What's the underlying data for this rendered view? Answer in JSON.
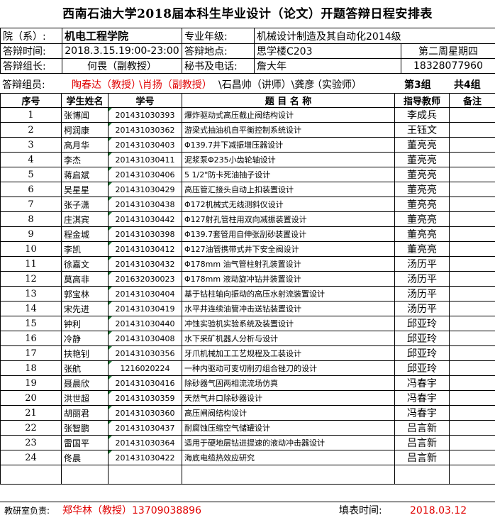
{
  "title": "西南石油大学2018届本科生毕业设计（论文）开题答辩日程安排表",
  "info": {
    "dept_label": "院（系）:",
    "dept_value": "机电工程学院",
    "major_label": "专业年级:",
    "major_value": "机械设计制造及其自动化2014级",
    "time_label": "答辩时间:",
    "time_value": "2018.3.15.19:00-23:00",
    "place_label": "答辩地点:",
    "place_value": "思学楼C203",
    "week_value": "第二周星期四",
    "leader_label": "答辩组长:",
    "leader_value": "何畏（副教授）",
    "secretary_label": "秘书及电话:",
    "secretary_name": "詹大年",
    "secretary_phone": "18328077960",
    "members_label": "答辩组员:",
    "member_1": "陶春达（教授）",
    "member_2": "\\肖扬（副教授）",
    "member_3": "\\石昌帅（讲师）\\龚彦",
    "member_4": "（实验师）",
    "group_value": "第3组",
    "total_value": "共4组"
  },
  "columns": {
    "no": "序号",
    "student": "学生姓名",
    "id": "学号",
    "topic": "题 目 名 称",
    "advisor": "指导教师",
    "note": "备注"
  },
  "rows": [
    {
      "no": "1",
      "student": "张博闻",
      "id": "201431030393",
      "topic": "爆炸驱动式高压截止阀结构设计",
      "advisor": "李成兵"
    },
    {
      "no": "2",
      "student": "柯润康",
      "id": "201431030362",
      "topic": "游梁式抽油机自平衡控制系统设计",
      "advisor": "王钰文"
    },
    {
      "no": "3",
      "student": "高月华",
      "id": "201431030403",
      "topic": "Φ139.7井下减振增压器设计",
      "advisor": "董亮亮"
    },
    {
      "no": "4",
      "student": "李杰",
      "id": "201431030411",
      "topic": "泥浆泵Φ235小齿轮轴设计",
      "advisor": "董亮亮"
    },
    {
      "no": "5",
      "student": "蒋启斌",
      "id": "201431030406",
      "topic": "5 1/2\"防卡死油抽子设计",
      "advisor": "董亮亮"
    },
    {
      "no": "6",
      "student": "吴星星",
      "id": "201431030429",
      "topic": "高压管汇接头自动上扣装置设计",
      "advisor": "董亮亮"
    },
    {
      "no": "7",
      "student": "张子潇",
      "id": "201431030438",
      "topic": "Φ172机械式无线测斜仪设计",
      "advisor": "董亮亮"
    },
    {
      "no": "8",
      "student": "庄淇宾",
      "id": "201431030442",
      "topic": "Φ127射孔管柱用双向减振装置设计",
      "advisor": "董亮亮"
    },
    {
      "no": "9",
      "student": "程金城",
      "id": "201431030398",
      "topic": "Φ139.7套管用自伸张刮砂装置设计",
      "advisor": "董亮亮"
    },
    {
      "no": "10",
      "student": "李凯",
      "id": "201431030412",
      "topic": "Φ127油管携带式井下安全阀设计",
      "advisor": "董亮亮"
    },
    {
      "no": "11",
      "student": "徐嘉文",
      "id": "201431030432",
      "topic": "Φ178mm 油气管柱射孔装置设计",
      "advisor": "汤历平"
    },
    {
      "no": "12",
      "student": "莫高非",
      "id": "201632030023",
      "topic": "Φ178mm 液动旋冲钻井装置设计",
      "advisor": "汤历平"
    },
    {
      "no": "13",
      "student": "郭宝林",
      "id": "201431030404",
      "topic": "基于钻柱轴向振动的高压水射流装置设计",
      "advisor": "汤历平"
    },
    {
      "no": "14",
      "student": "宋先进",
      "id": "201431030419",
      "topic": "水平井连续油管冲击送钻装置设计",
      "advisor": "汤历平"
    },
    {
      "no": "15",
      "student": "钟利",
      "id": "201431030440",
      "topic": "冲蚀实验机实验系统及装置设计",
      "advisor": "邱亚玲"
    },
    {
      "no": "16",
      "student": "冷静",
      "id": "201431030408",
      "topic": "水下采矿机器人分析与设计",
      "advisor": "邱亚玲"
    },
    {
      "no": "17",
      "student": "扶艳钊",
      "id": "201431030356",
      "topic": "牙爪机械加工工艺规程及工装设计",
      "advisor": "邱亚玲"
    },
    {
      "no": "18",
      "student": "张航",
      "id": "1216020224",
      "topic": "一种内驱动可变切削刃组合锉刀的设计",
      "advisor": "邱亚玲"
    },
    {
      "no": "19",
      "student": "聂晨欣",
      "id": "201431030416",
      "topic": "除砂器气固两相流流场仿真",
      "advisor": "冯春宇"
    },
    {
      "no": "20",
      "student": "洪世超",
      "id": "201431030359",
      "topic": "天然气井口除砂器设计",
      "advisor": "冯春宇"
    },
    {
      "no": "21",
      "student": "胡丽君",
      "id": "201431030360",
      "topic": "高压闸阀结构设计",
      "advisor": "冯春宇"
    },
    {
      "no": "22",
      "student": "张智鹏",
      "id": "201431030437",
      "topic": "耐腐蚀压缩空气储罐设计",
      "advisor": "吕言新"
    },
    {
      "no": "23",
      "student": "雷国平",
      "id": "201431030364",
      "topic": "适用于硬地层钻进提速的液动冲击器设计",
      "advisor": "吕言新"
    },
    {
      "no": "24",
      "student": "佟晨",
      "id": "201431030422",
      "topic": "海底电缆热效应研究",
      "advisor": "吕言新"
    }
  ],
  "footer": {
    "office_label": "教研室负责:",
    "office_value": "郑华林（教授）13709038896",
    "date_label": "填表时间:",
    "date_value": "2018.03.12"
  }
}
